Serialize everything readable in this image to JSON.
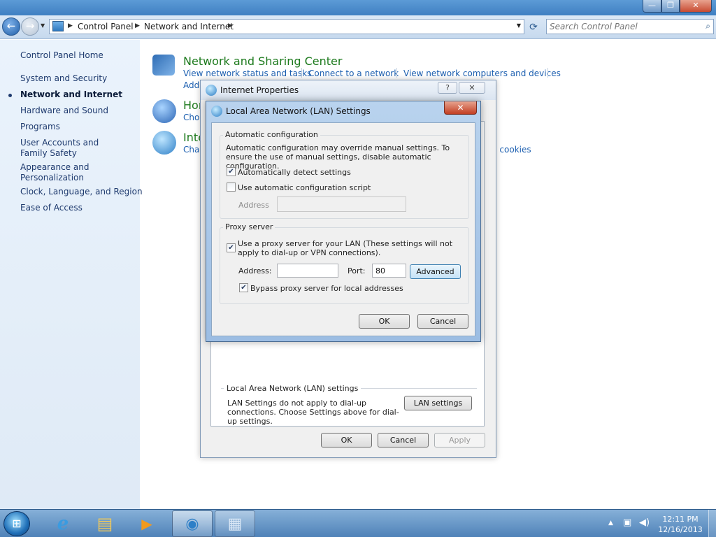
{
  "window": {
    "min_glyph": "—",
    "max_glyph": "❐",
    "close_glyph": "✕"
  },
  "navigation": {
    "back_glyph": "←",
    "forward_glyph": "→",
    "breadcrumb": [
      "Control Panel",
      "Network and Internet"
    ],
    "search_placeholder": "Search Control Panel"
  },
  "sidebar": {
    "home": "Control Panel Home",
    "items": [
      {
        "label": "System and Security",
        "active": false
      },
      {
        "label": "Network and Internet",
        "active": true
      },
      {
        "label": "Hardware and Sound",
        "active": false
      },
      {
        "label": "Programs",
        "active": false
      },
      {
        "label": "User Accounts and Family Safety",
        "active": false
      },
      {
        "label": "Appearance and Personalization",
        "active": false
      },
      {
        "label": "Clock, Language, and Region",
        "active": false
      },
      {
        "label": "Ease of Access",
        "active": false
      }
    ]
  },
  "main": {
    "categories": [
      {
        "title": "Network and Sharing Center",
        "links": [
          "View network status and tasks",
          "Connect to a network",
          "View network computers and devices",
          "Add"
        ]
      },
      {
        "title": "Hor",
        "links": [
          "Choc"
        ]
      },
      {
        "title": "Inte",
        "links": [
          "Char",
          "d cookies"
        ]
      }
    ]
  },
  "internet_properties": {
    "title": "Internet Properties",
    "help_glyph": "?",
    "close_glyph": "✕",
    "lan_group_label": "Local Area Network (LAN) settings",
    "lan_text": "LAN Settings do not apply to dial-up connections. Choose Settings above for dial-up settings.",
    "lan_button": "LAN settings",
    "ok": "OK",
    "cancel": "Cancel",
    "apply": "Apply"
  },
  "lan_settings": {
    "title": "Local Area Network (LAN) Settings",
    "close_glyph": "✕",
    "auto_config": {
      "label": "Automatic configuration",
      "description": "Automatic configuration may override manual settings.  To ensure the use of manual settings, disable automatic configuration.",
      "detect_label": "Automatically detect settings",
      "detect_checked": true,
      "script_label": "Use automatic configuration script",
      "script_checked": false,
      "address_label": "Address",
      "address_value": ""
    },
    "proxy": {
      "label": "Proxy server",
      "use_proxy_label": "Use a proxy server for your LAN (These settings will not apply to dial-up or VPN connections).",
      "use_proxy_checked": true,
      "address_label": "Address:",
      "address_value": "",
      "port_label": "Port:",
      "port_value": "80",
      "advanced_label": "Advanced",
      "bypass_label": "Bypass proxy server for local addresses",
      "bypass_checked": true
    },
    "ok": "OK",
    "cancel": "Cancel",
    "check_glyph": "✔"
  },
  "taskbar": {
    "start_glyph": "⊞",
    "apps": [
      {
        "name": "internet-explorer",
        "glyph": "e",
        "state": "pinned"
      },
      {
        "name": "windows-explorer",
        "glyph": "▤",
        "state": "pinned"
      },
      {
        "name": "media-player",
        "glyph": "▶",
        "state": "pinned"
      },
      {
        "name": "control-panel",
        "glyph": "◉",
        "state": "active"
      },
      {
        "name": "network-settings",
        "glyph": "▦",
        "state": "open"
      }
    ],
    "tray_arrow": "▲",
    "time": "12:11 PM",
    "date": "12/16/2013"
  },
  "colors": {
    "link": "#1c5fb0",
    "category_title": "#1d7a1d",
    "taskbar": "#4f82b8"
  }
}
